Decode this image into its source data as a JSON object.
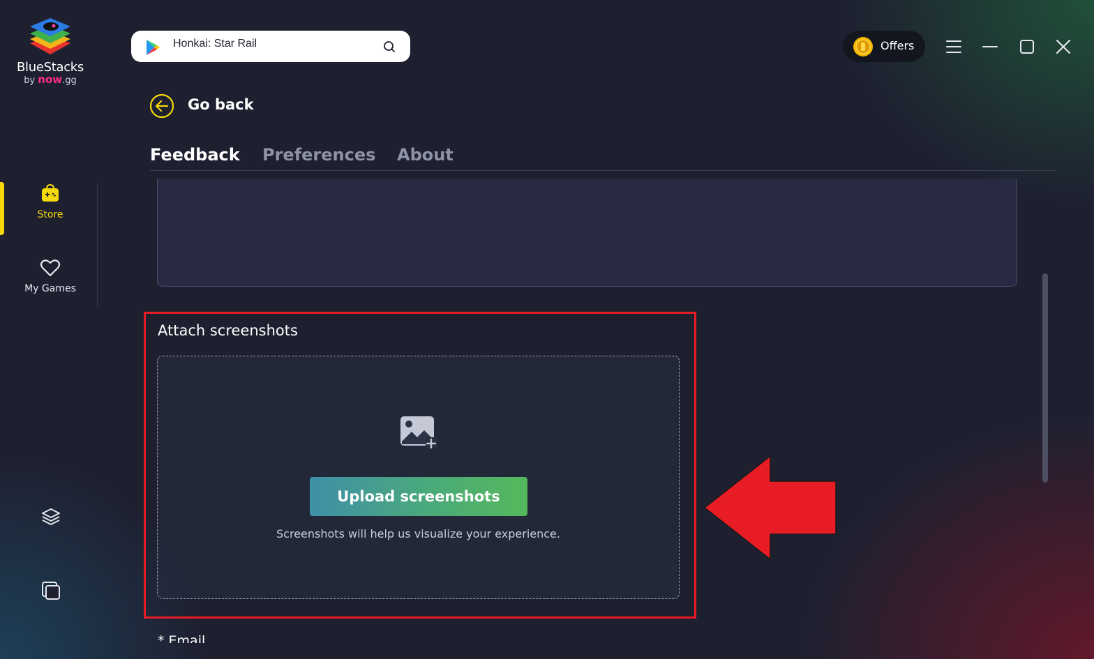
{
  "brand": {
    "name": "BlueStacks",
    "by": "by",
    "maker": "now",
    "maker_suffix": ".gg"
  },
  "sidebar": {
    "items": [
      {
        "label": "Store",
        "icon": "store-bag-icon",
        "active": true
      },
      {
        "label": "My Games",
        "icon": "heart-icon",
        "active": false
      }
    ],
    "bottom_icons": [
      "layers-icon",
      "multi-instance-icon"
    ]
  },
  "search": {
    "value": "Honkai: Star Rail",
    "icon": "google-play-icon"
  },
  "topbar": {
    "offers_label": "Offers",
    "window_controls": [
      "menu-icon",
      "minimize-icon",
      "maximize-icon",
      "close-icon"
    ]
  },
  "header": {
    "back_label": "Go back"
  },
  "tabs": [
    {
      "label": "Feedback",
      "active": true
    },
    {
      "label": "Preferences",
      "active": false
    },
    {
      "label": "About",
      "active": false
    }
  ],
  "attach": {
    "title": "Attach screenshots",
    "button_label": "Upload screenshots",
    "hint": "Screenshots will help us visualize your experience."
  },
  "email": {
    "label": "* Email"
  },
  "colors": {
    "accent_yellow": "#f5d90a",
    "highlight_red": "#e81c24",
    "button_gradient": [
      "#3f8fa8",
      "#55b85c"
    ]
  }
}
